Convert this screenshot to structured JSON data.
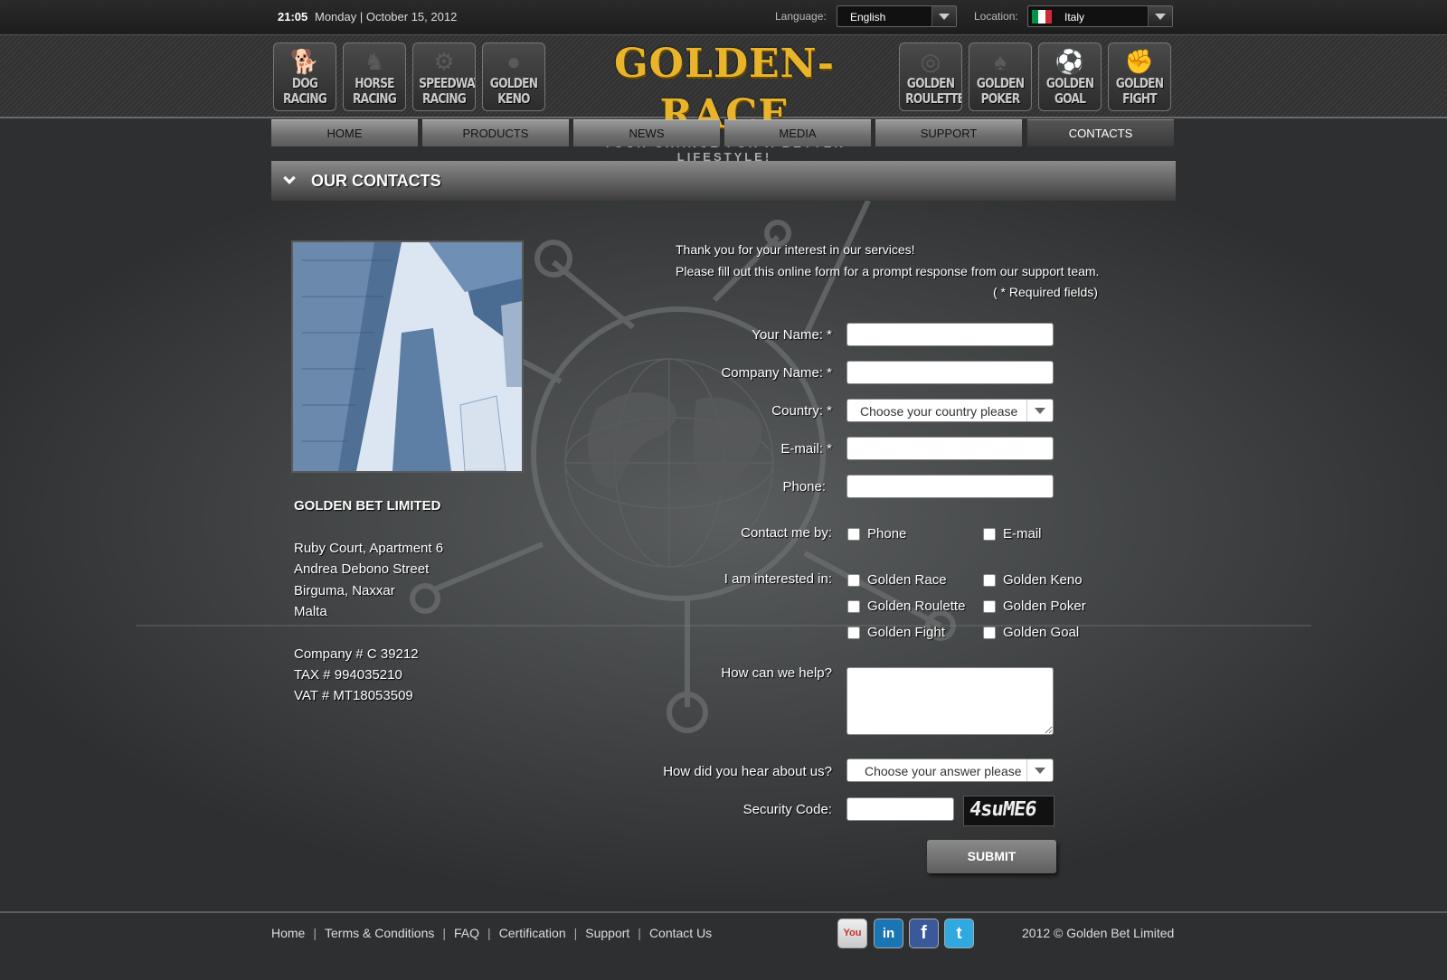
{
  "topbar": {
    "time": "21:05",
    "date": "Monday | October 15, 2012",
    "language_label": "Language:",
    "language_value": "English",
    "location_label": "Location:",
    "location_value": "Italy"
  },
  "header": {
    "games_left": [
      {
        "label": "DOG\nRACING",
        "icon": "dog-icon"
      },
      {
        "label": "HORSE\nRACING",
        "icon": "horse-icon"
      },
      {
        "label": "SPEEDWAY\nRACING",
        "icon": "motorbike-icon"
      },
      {
        "label": "GOLDEN\nKENO",
        "icon": "keno-ball-icon"
      }
    ],
    "logo_name": "GOLDEN-RACE",
    "logo_tagline": "YOUR CHANCE FOR A BETTER LIFESTYLE!",
    "games_right": [
      {
        "label": "GOLDEN\nROULETTE",
        "icon": "roulette-icon"
      },
      {
        "label": "GOLDEN\nPOKER",
        "icon": "cards-icon"
      },
      {
        "label": "GOLDEN\nGOAL",
        "icon": "football-icon"
      },
      {
        "label": "GOLDEN\nFIGHT",
        "icon": "boxing-glove-icon"
      }
    ]
  },
  "nav": {
    "tabs": [
      "HOME",
      "PRODUCTS",
      "NEWS",
      "MEDIA",
      "SUPPORT",
      "CONTACTS"
    ],
    "active": "CONTACTS"
  },
  "section": {
    "title": "OUR CONTACTS"
  },
  "company": {
    "name": "GOLDEN BET LIMITED",
    "address": [
      "Ruby Court, Apartment 6",
      "Andrea Debono Street",
      "Birguma, Naxxar",
      "Malta"
    ],
    "ids": [
      "Company # C 39212",
      "TAX # 994035210",
      "VAT # MT18053509"
    ]
  },
  "form": {
    "intro1": "Thank you for your interest in our services!",
    "intro2": "Please fill out this online form for a prompt response from our support team.",
    "required_note": "( * Required fields)",
    "name_label": "Your Name: *",
    "company_label": "Company Name: *",
    "country_label": "Country: *",
    "country_value": "Choose your country please",
    "email_label": "E-mail: *",
    "phone_label": "Phone:",
    "contact_label": "Contact me by:",
    "contact_options": [
      "Phone",
      "E-mail"
    ],
    "interest_label": "I am interested in:",
    "interest_options": [
      "Golden Race",
      "Golden Keno",
      "Golden Roulette",
      "Golden Poker",
      "Golden Fight",
      "Golden Goal"
    ],
    "help_label": "How can we help?",
    "hear_label": "How did you hear about us?",
    "hear_value": "Choose your answer please",
    "security_label": "Security Code:",
    "captcha_text": "4suME6",
    "submit_label": "SUBMIT"
  },
  "footer": {
    "links": [
      "Home",
      "Terms & Conditions",
      "FAQ",
      "Certification",
      "Support",
      "Contact Us"
    ],
    "social": [
      {
        "name": "youtube-icon",
        "glyph": "You",
        "color": "#c4302b"
      },
      {
        "name": "linkedin-icon",
        "glyph": "in",
        "color": "#1a75b5"
      },
      {
        "name": "facebook-icon",
        "glyph": "f",
        "color": "#3b5998"
      },
      {
        "name": "twitter-icon",
        "glyph": "t",
        "color": "#2fa9e0"
      }
    ],
    "copyright": "2012 © Golden Bet Limited"
  }
}
